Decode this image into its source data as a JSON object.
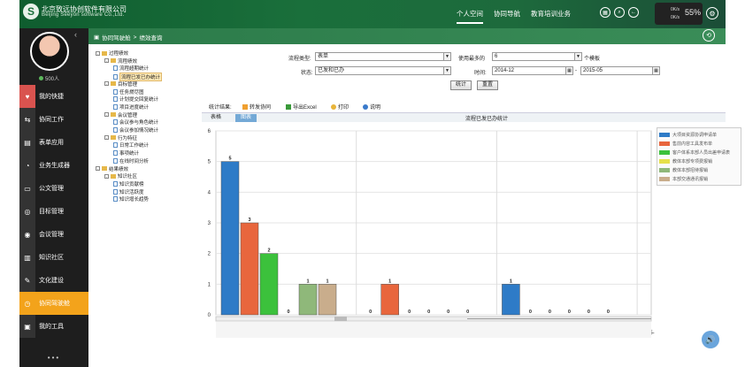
{
  "header": {
    "company_cn": "北京致远协创软件有限公司",
    "company_en": "Beijing Seeyon software Co.,Ltd.",
    "nav": [
      "个人空间",
      "协同导航",
      "教育培训业务"
    ],
    "net_up": "0K/s",
    "net_down": "0K/s",
    "battery_pct": "55%"
  },
  "sidebar": {
    "score": "500人",
    "items": [
      {
        "label": "我的快捷",
        "icon": "heart-icon",
        "color": "#d9534f"
      },
      {
        "label": "协同工作",
        "icon": "flow-icon",
        "color": "#333"
      },
      {
        "label": "表单应用",
        "icon": "form-icon",
        "color": "#333"
      },
      {
        "label": "业务生成器",
        "icon": "pie-icon",
        "color": "#333"
      },
      {
        "label": "公文管理",
        "icon": "doc-icon",
        "color": "#333"
      },
      {
        "label": "目标管理",
        "icon": "target-icon",
        "color": "#333"
      },
      {
        "label": "会议管理",
        "icon": "meeting-icon",
        "color": "#333"
      },
      {
        "label": "知识社区",
        "icon": "book-icon",
        "color": "#333"
      },
      {
        "label": "文化建设",
        "icon": "culture-icon",
        "color": "#333"
      },
      {
        "label": "协同驾驶舱",
        "icon": "cockpit-icon",
        "color": "#f3a31b"
      },
      {
        "label": "我的工具",
        "icon": "tools-icon",
        "color": "#333"
      }
    ]
  },
  "breadcrumb": {
    "part1": "协同驾驶舱",
    "sep": ">",
    "part2": "绩效查询"
  },
  "tree": [
    {
      "label": "过程绩效",
      "level": 0,
      "type": "folder"
    },
    {
      "label": "流程绩效",
      "level": 1,
      "type": "folder"
    },
    {
      "label": "流程超期统计",
      "level": 2,
      "type": "doc"
    },
    {
      "label": "流程已发已办统计",
      "level": 2,
      "type": "doc",
      "selected": true
    },
    {
      "label": "目标管理",
      "level": 1,
      "type": "folder"
    },
    {
      "label": "任务燃尽图",
      "level": 2,
      "type": "doc"
    },
    {
      "label": "计划提交回复统计",
      "level": 2,
      "type": "doc"
    },
    {
      "label": "项目进度统计",
      "level": 2,
      "type": "doc"
    },
    {
      "label": "会议管理",
      "level": 1,
      "type": "folder"
    },
    {
      "label": "会议参与角色统计",
      "level": 2,
      "type": "doc"
    },
    {
      "label": "会议参加情况统计",
      "level": 2,
      "type": "doc"
    },
    {
      "label": "行为特征",
      "level": 1,
      "type": "folder"
    },
    {
      "label": "日常工作统计",
      "level": 2,
      "type": "doc"
    },
    {
      "label": "事项统计",
      "level": 2,
      "type": "doc"
    },
    {
      "label": "在线时间分析",
      "level": 2,
      "type": "doc"
    },
    {
      "label": "结果绩效",
      "level": 0,
      "type": "folder"
    },
    {
      "label": "知识社区",
      "level": 1,
      "type": "folder"
    },
    {
      "label": "知识贡献榜",
      "level": 2,
      "type": "doc"
    },
    {
      "label": "知识活跃度",
      "level": 2,
      "type": "doc"
    },
    {
      "label": "知识增长趋势",
      "level": 2,
      "type": "doc"
    }
  ],
  "form": {
    "flow_type_label": "流程类型:",
    "flow_type_value": "表单",
    "status_label": "状态:",
    "status_value": "已发和已办",
    "most_used_label": "使用最多的",
    "most_used_value": "6",
    "most_used_suffix": "个模板",
    "time_label": "时间:",
    "time_from": "2014-12",
    "time_to": "2015-05",
    "time_sep": "-",
    "stat_btn": "统计",
    "reset_btn": "重置"
  },
  "toolbar": {
    "result_label": "统计结果:",
    "forward": "转发协同",
    "export": "导出Excel",
    "print": "打印",
    "help": "说明"
  },
  "tabs": [
    "表格",
    "图表"
  ],
  "chart_title": "流程已发已办统计",
  "chart_data": {
    "type": "bar",
    "title": "流程已发已办统计",
    "ylim": [
      0,
      6
    ],
    "yticks": [
      0,
      1,
      2,
      3,
      4,
      5,
      6
    ],
    "categories": [
      "2014-12",
      "2015-01",
      "2015-02",
      "2015-"
    ],
    "series": [
      {
        "name": "大项目资源协调申请单",
        "color": "#2e7bc7",
        "values": [
          5,
          0,
          1,
          null
        ]
      },
      {
        "name": "售前内容工具发布单",
        "color": "#e8663d",
        "values": [
          3,
          1,
          0,
          null
        ]
      },
      {
        "name": "客户体系本部人员出差申请表",
        "color": "#3cc13c",
        "values": [
          2,
          0,
          0,
          null
        ]
      },
      {
        "name": "教体本部专项费报销",
        "color": "#e6e04a",
        "values": [
          0,
          0,
          0,
          null
        ]
      },
      {
        "name": "教体本部招待报销",
        "color": "#8fb87a",
        "values": [
          1,
          0,
          0,
          null
        ]
      },
      {
        "name": "本部交通通讯报销",
        "color": "#c9ad8c",
        "values": [
          1,
          0,
          0,
          null
        ]
      }
    ]
  }
}
